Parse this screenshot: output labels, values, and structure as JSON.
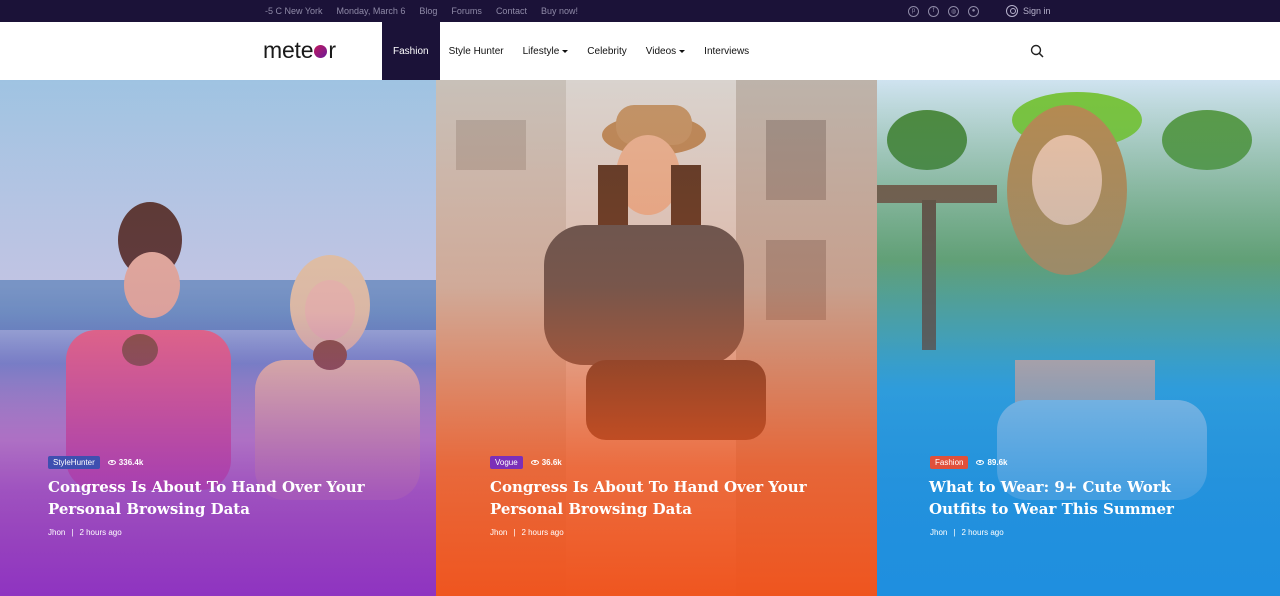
{
  "topbar": {
    "weather": "-5 C  New York",
    "date": "Monday, March 6",
    "links": [
      "Blog",
      "Forums",
      "Contact",
      "Buy now!"
    ],
    "social_icons": [
      "pinterest-icon",
      "facebook-icon",
      "dribbble-icon",
      "github-icon"
    ],
    "signin_label": "Sign in"
  },
  "nav": {
    "logo_left": "mete",
    "logo_right": "r",
    "items": [
      {
        "label": "Fashion",
        "active": true,
        "dropdown": false
      },
      {
        "label": "Style Hunter",
        "active": false,
        "dropdown": false
      },
      {
        "label": "Lifestyle",
        "active": false,
        "dropdown": true
      },
      {
        "label": "Celebrity",
        "active": false,
        "dropdown": false
      },
      {
        "label": "Videos",
        "active": false,
        "dropdown": true
      },
      {
        "label": "Interviews",
        "active": false,
        "dropdown": false
      }
    ],
    "search_icon": "search-icon"
  },
  "cards": [
    {
      "tag": "StyleHunter",
      "tag_color": "#3f4fb0",
      "views": "336.4k",
      "title": "Congress Is About To Hand Over Your Personal Browsing Data",
      "author": "Jhon",
      "time": "2 hours ago"
    },
    {
      "tag": "Vogue",
      "tag_color": "#7b2fb8",
      "views": "36.6k",
      "title": "Congress Is About To Hand Over Your Personal Browsing Data",
      "author": "Jhon",
      "time": "2 hours ago"
    },
    {
      "tag": "Fashion",
      "tag_color": "#e0503a",
      "views": "89.6k",
      "title": "What to Wear: 9+ Cute Work Outfits to Wear This Summer",
      "author": "Jhon",
      "time": "2 hours ago"
    }
  ],
  "colors": {
    "topbar_bg": "#1b1238",
    "active_nav_bg": "#1b1238",
    "card1_gradient": "#8c2ec4",
    "card2_gradient": "#f0531c",
    "card3_gradient": "#1e8fe0"
  }
}
